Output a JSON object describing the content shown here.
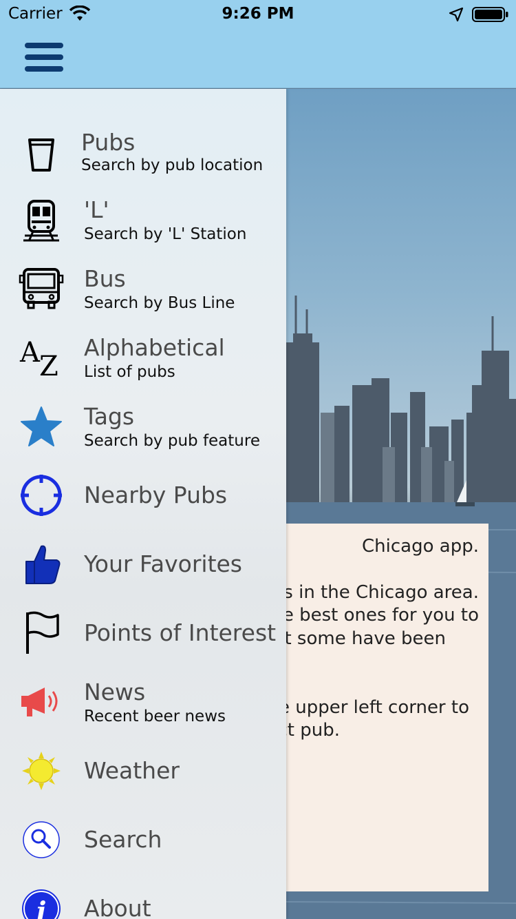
{
  "status_bar": {
    "carrier": "Carrier",
    "time": "9:26 PM"
  },
  "nav": {
    "menu_icon": "hamburger-icon"
  },
  "menu": {
    "items": [
      {
        "title": "Pubs",
        "subtitle": "Search by pub location",
        "icon": "pint-glass-icon"
      },
      {
        "title": "'L'",
        "subtitle": "Search by 'L' Station",
        "icon": "train-icon"
      },
      {
        "title": "Bus",
        "subtitle": "Search by Bus Line",
        "icon": "bus-icon"
      },
      {
        "title": "Alphabetical",
        "subtitle": "List of pubs",
        "icon": "a-z-icon"
      },
      {
        "title": "Tags",
        "subtitle": "Search by pub feature",
        "icon": "star-icon"
      },
      {
        "title": "Nearby Pubs",
        "icon": "crosshair-icon"
      },
      {
        "title": "Your Favorites",
        "icon": "thumbs-up-icon"
      },
      {
        "title": "Points of Interest",
        "icon": "flag-icon"
      },
      {
        "title": "News",
        "subtitle": "Recent beer news",
        "icon": "megaphone-icon"
      },
      {
        "title": "Weather",
        "icon": "sun-icon"
      },
      {
        "title": "Search",
        "icon": "magnifier-icon"
      },
      {
        "title": "About",
        "icon": "info-icon"
      }
    ]
  },
  "welcome_card": {
    "lines": [
      "Chicago app.",
      "s in the Chicago area.",
      "e best ones for you to",
      "ut some have been",
      "e upper left corner to",
      "ct pub."
    ]
  },
  "colors": {
    "nav_bar": "#98d0ee",
    "menu_icon": "#0d3b70",
    "card": "#f8eee6",
    "star": "#2a7fc9",
    "blue": "#1a2ee0"
  }
}
